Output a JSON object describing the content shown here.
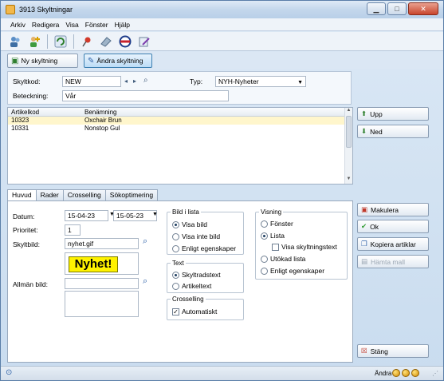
{
  "window": {
    "title": "3913 Skyltningar"
  },
  "menu": [
    "Arkiv",
    "Redigera",
    "Visa",
    "Fönster",
    "Hjälp"
  ],
  "toolbar_icons": [
    "users-icon",
    "user-add-icon",
    "refresh-icon",
    "pin-icon",
    "eraser-icon",
    "badge-icon",
    "edit-icon"
  ],
  "subbar": {
    "new_label": "Ny skyltning",
    "edit_label": "Ändra skyltning"
  },
  "form": {
    "code_label": "Skyltkod:",
    "code_value": "NEW",
    "type_label": "Typ:",
    "type_value": "NYH-Nyheter",
    "desc_label": "Beteckning:",
    "desc_value": "Vår"
  },
  "list": {
    "columns": [
      "Artikelkod",
      "Benämning"
    ],
    "rows": [
      {
        "code": "10323",
        "name": "Oxchair Brun",
        "selected": true
      },
      {
        "code": "10331",
        "name": "Nonstop Gul",
        "selected": false
      }
    ]
  },
  "side_buttons": {
    "up": "Upp",
    "down": "Ned",
    "cancel": "Makulera",
    "ok": "Ok",
    "copy": "Kopiera artiklar",
    "fetch": "Hämta mall",
    "close": "Stäng"
  },
  "tabs": [
    "Huvud",
    "Rader",
    "Crosselling",
    "Sökoptimering"
  ],
  "main": {
    "date_label": "Datum:",
    "date_from": "15-04-23",
    "date_sep": "-",
    "date_to": "15-05-23",
    "priority_label": "Prioritet:",
    "priority_value": "1",
    "image_label": "Skyltbild:",
    "image_value": "nyhet.gif",
    "image_text": "Nyhet!",
    "general_image_label": "Allmän bild:"
  },
  "bild_i_lista": {
    "title": "Bild i lista",
    "options": [
      "Visa bild",
      "Visa inte bild",
      "Enligt egenskaper"
    ],
    "selected": 0
  },
  "text_group": {
    "title": "Text",
    "options": [
      "Skyltradstext",
      "Artikeltext"
    ],
    "selected": 0
  },
  "crosselling": {
    "title": "Crosselling",
    "checkbox": "Automatiskt",
    "checked": true
  },
  "visning": {
    "title": "Visning",
    "options": [
      "Fönster",
      "Lista",
      "Utökad lista",
      "Enligt egenskaper"
    ],
    "selected": 1,
    "sub_checkbox": "Visa skyltningstext"
  },
  "status": {
    "text": "Ändra"
  }
}
